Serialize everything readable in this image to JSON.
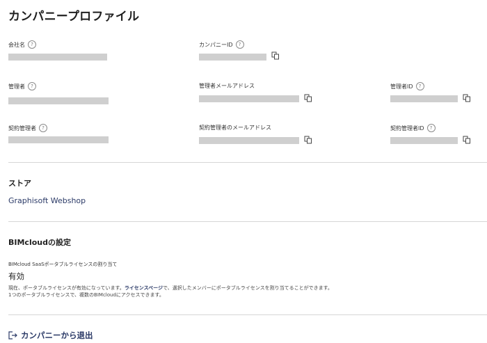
{
  "page": {
    "title": "カンパニープロファイル"
  },
  "fields": {
    "company_name": {
      "label": "会社名"
    },
    "company_id": {
      "label": "カンパニーID"
    },
    "admin": {
      "label": "管理者"
    },
    "admin_email": {
      "label": "管理者メールアドレス"
    },
    "admin_id": {
      "label": "管理者ID"
    },
    "contract_admin": {
      "label": "契約管理者"
    },
    "contract_admin_email": {
      "label": "契約管理者のメールアドレス"
    },
    "contract_admin_id": {
      "label": "契約管理者ID"
    }
  },
  "store": {
    "heading": "ストア",
    "link": "Graphisoft Webshop"
  },
  "bimcloud": {
    "heading": "BIMcloudの設定",
    "setting_label": "BIMcloud SaaSポータブルライセンスの割り当て",
    "setting_value": "有効",
    "desc_part1": "現在、ポータブルライセンスが有効になっています。",
    "desc_link": "ライセンスページ",
    "desc_part2": "で、選択したメンバーにポータブルライセンスを割り当てることができます。",
    "desc_line2": "1つのポータブルライセンスで、複数のBIMcloudにアクセスできます。"
  },
  "leave": {
    "label": "カンパニーから退出",
    "icon": "exit-icon"
  },
  "icons": {
    "help": "question-mark-icon",
    "copy": "copy-icon"
  },
  "colors": {
    "accent": "#2b3a67",
    "placeholder": "#cfcfcf",
    "divider": "#d6d6d6"
  }
}
